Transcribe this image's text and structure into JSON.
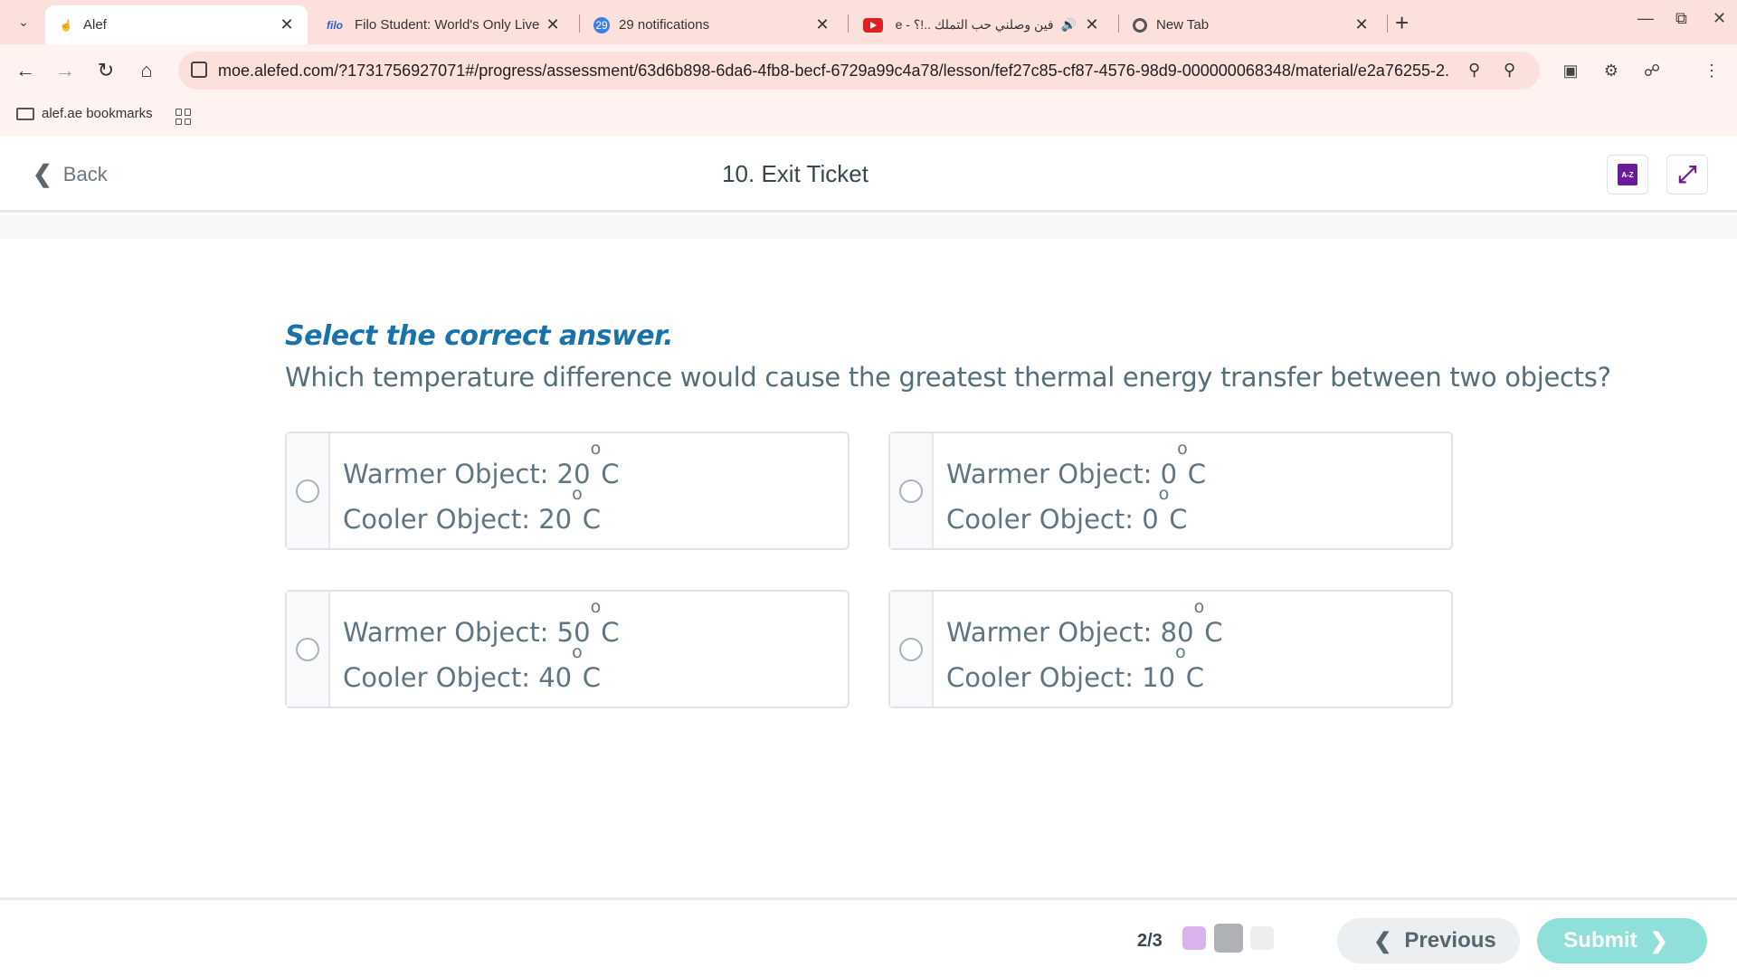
{
  "browser": {
    "tabs": [
      {
        "title": "Alef",
        "active": true
      },
      {
        "title": "Filo Student: World's Only Live",
        "favicon_text": "filo",
        "active": false
      },
      {
        "title": "29 notifications",
        "badge": "29",
        "active": false
      },
      {
        "title": "فين وصلني حب التملك ..!؟ - e",
        "active": false
      },
      {
        "title": "New Tab",
        "active": false
      }
    ],
    "url": "moe.alefed.com/?1731756927071#/progress/assessment/63d6b898-6da6-4fb8-becf-6729a99c4a78/lesson/fef27c85-cf87-4576-98d9-000000068348/material/e2a76255-2...",
    "bookmarks": [
      {
        "label": "alef.ae bookmarks"
      }
    ]
  },
  "header": {
    "back_label": "Back",
    "title": "10. Exit Ticket",
    "glossary_icon_text": "A-Z"
  },
  "question": {
    "instruction": "Select the correct answer.",
    "prompt": "Which temperature difference would cause the greatest thermal energy transfer between two objects?",
    "unit_degree": "o",
    "unit_letter": "C",
    "options": [
      {
        "warmer_label": "Warmer Object: 20",
        "cooler_label": "Cooler Object: 20",
        "selected": false
      },
      {
        "warmer_label": "Warmer Object: 0",
        "cooler_label": "Cooler Object: 0",
        "selected": false
      },
      {
        "warmer_label": "Warmer Object: 50",
        "cooler_label": "Cooler Object: 40",
        "selected": false
      },
      {
        "warmer_label": "Warmer Object: 80",
        "cooler_label": "Cooler Object: 10",
        "selected": false
      }
    ]
  },
  "footer": {
    "progress": "2/3",
    "dot_colors": [
      "#d9b3ee",
      "#aeb2b5",
      "#eceeef"
    ],
    "previous_label": "Previous",
    "submit_label": "Submit"
  },
  "colors": {
    "accent": "#1a73a8",
    "glossary": "#6a1b9a",
    "submit": "#8fe0d8"
  }
}
